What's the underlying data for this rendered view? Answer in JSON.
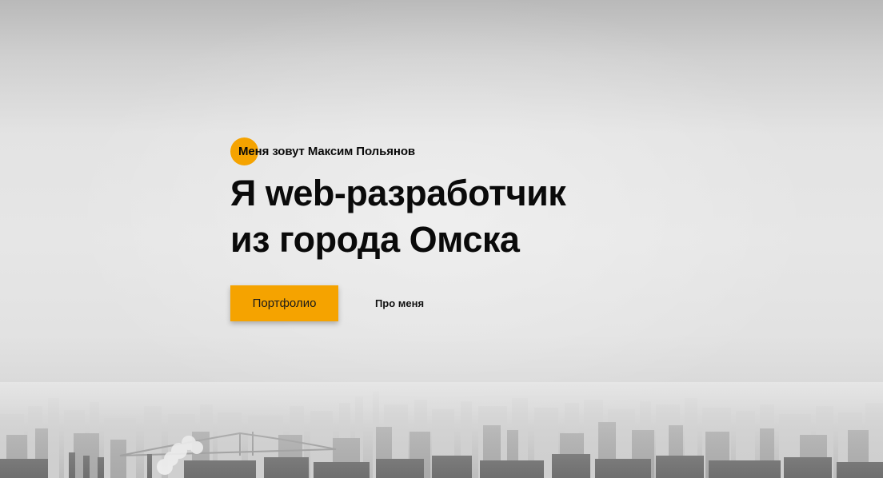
{
  "hero": {
    "intro": "Меня зовут Максим Польянов",
    "headline_line1_bold": "Я web-",
    "headline_line1_rest": "разработчик",
    "headline_line2": "из города Омска"
  },
  "actions": {
    "portfolio_label": "Портфолио",
    "about_label": "Про меня"
  },
  "colors": {
    "accent": "#f5a300",
    "text": "#0a0a0a",
    "background": "#e4e4e4"
  }
}
